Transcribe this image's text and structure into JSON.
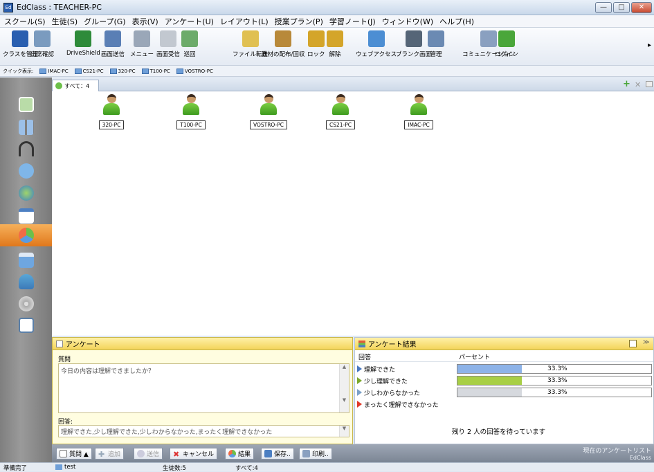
{
  "window": {
    "title": "EdClass : TEACHER-PC",
    "minimize": "—",
    "maximize": "□",
    "close": "✕"
  },
  "menu": [
    "スクール(S)",
    "生徒(S)",
    "グループ(G)",
    "表示(V)",
    "アンケート(U)",
    "レイアウト(L)",
    "授業プラン(P)",
    "学習ノート(J)",
    "ウィンドウ(W)",
    "ヘルプ(H)"
  ],
  "toolbar": {
    "items": [
      {
        "label": "クラスを管理",
        "icon": "class-manage-icon",
        "color": "#2a5fb0"
      },
      {
        "label": "出席確認",
        "icon": "attendance-icon",
        "color": "#7a9bbf"
      },
      {
        "label": "DriveShield",
        "icon": "shield-icon",
        "color": "#2e8b3a"
      },
      {
        "label": "画面送信",
        "icon": "screen-send-icon",
        "color": "#5a7fb5"
      },
      {
        "label": "メニュー",
        "icon": "menu-icon",
        "color": "#9aa7b8"
      },
      {
        "label": "画面受信",
        "icon": "screen-receive-icon",
        "color": "#c2c8d0"
      },
      {
        "label": "巡回",
        "icon": "patrol-icon",
        "color": "#6cab6a"
      },
      {
        "label": "ファイル転送",
        "icon": "file-transfer-icon",
        "color": "#e0c052"
      },
      {
        "label": "教材の配布/回収",
        "icon": "material-distribute-icon",
        "color": "#b8893a"
      },
      {
        "label": "ロック",
        "icon": "lock-icon",
        "color": "#d4a52a"
      },
      {
        "label": "解除",
        "icon": "unlock-icon",
        "color": "#d4a52a"
      },
      {
        "label": "ウェブアクセス",
        "icon": "web-access-icon",
        "color": "#4c8ed3"
      },
      {
        "label": "ブランク画面",
        "icon": "blank-screen-icon",
        "color": "#556577"
      },
      {
        "label": "管理",
        "icon": "manage-icon",
        "color": "#6b8ab3"
      },
      {
        "label": "コミュニケーション",
        "icon": "communication-icon",
        "color": "#8aa0c0"
      },
      {
        "label": "ログイン",
        "icon": "login-icon",
        "color": "#4aa63a"
      }
    ],
    "more": "▸"
  },
  "quick": {
    "label": "クイック表示:",
    "items": [
      "IMAC-PC",
      "CS21-PC",
      "320-PC",
      "T100-PC",
      "VOSTRO-PC"
    ]
  },
  "sidebar": [
    "home-icon",
    "layout-icon",
    "headset-icon",
    "question-icon",
    "globe-icon",
    "window-icon",
    "survey-pie-icon",
    "printer-icon",
    "user-icon",
    "disc-icon",
    "chart-icon"
  ],
  "tab": {
    "label": "すべて：4",
    "add": "+",
    "remove": "✕"
  },
  "students": [
    "320-PC",
    "T100-PC",
    "VOSTRO-PC",
    "CS21-PC",
    "IMAC-PC"
  ],
  "survey": {
    "title": "アンケート",
    "question_label": "質問",
    "question": "今日の内容は理解できましたか？",
    "answer_label": "回答:",
    "answers": "理解できた,少し理解できた,少しわからなかった,まったく理解できなかった"
  },
  "results": {
    "title": "アンケート結果",
    "col_answer": "回答",
    "col_percent": "パーセント",
    "rows": [
      {
        "answer": "理解できた",
        "percent": "33.3%",
        "fill": 0.333,
        "color": "#8db3e8",
        "flag": "#4a78c0"
      },
      {
        "answer": "少し理解できた",
        "percent": "33.3%",
        "fill": 0.333,
        "color": "#a8cf45",
        "flag": "#7aa82a"
      },
      {
        "answer": "少しわからなかった",
        "percent": "33.3%",
        "fill": 0.333,
        "color": "#d6d9de",
        "flag": "#7aa0c8"
      },
      {
        "answer": "まったく理解できなかった",
        "percent": "",
        "fill": 0,
        "color": "#e03b2b",
        "flag": "#e03b2b"
      }
    ],
    "waiting": "残り 2 人の回答を待っています"
  },
  "bottom": {
    "question": "質問 ▲",
    "add": "追加",
    "send": "送信",
    "cancel": "キャンセル",
    "result": "結果",
    "save": "保存..",
    "print": "印刷..",
    "list_label": "現在のアンケートリスト",
    "brand": "EdClass"
  },
  "status": {
    "ready": "準備完了",
    "item": "test",
    "count": "生徒数:5",
    "all": "すべて:4"
  }
}
